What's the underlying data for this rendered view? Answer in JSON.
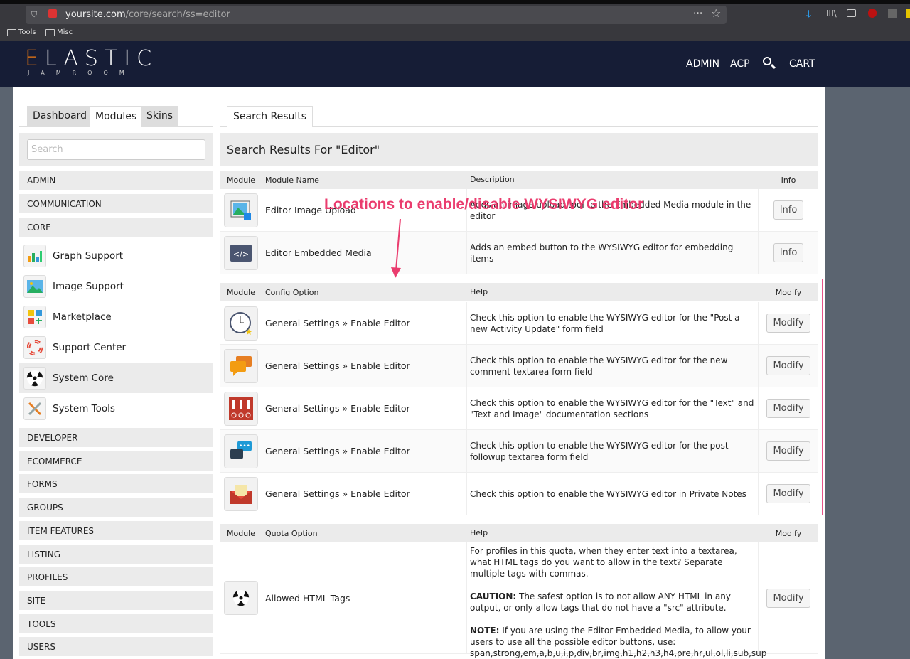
{
  "browser": {
    "url_domain": "yoursite.com",
    "url_path": "/core/search/ss=editor",
    "bookmarks": [
      "Tools",
      "Misc"
    ]
  },
  "header": {
    "logo_main": "ELASTIC",
    "logo_sub": "JAMROOM",
    "nav": [
      "ADMIN",
      "ACP",
      "CART"
    ],
    "search_icon": "search-icon"
  },
  "tabs": {
    "left": [
      "Dashboard",
      "Modules",
      "Skins"
    ],
    "active": "Modules",
    "right": "Search Results"
  },
  "sidebar": {
    "search_placeholder": "Search",
    "categories_top": [
      "ADMIN",
      "COMMUNICATION",
      "CORE"
    ],
    "modules": [
      {
        "label": "Graph Support",
        "icon": "bar-chart-icon"
      },
      {
        "label": "Image Support",
        "icon": "image-icon"
      },
      {
        "label": "Marketplace",
        "icon": "grid-plus-icon"
      },
      {
        "label": "Support Center",
        "icon": "lifebuoy-icon"
      },
      {
        "label": "System Core",
        "icon": "radiation-icon",
        "selected": true
      },
      {
        "label": "System Tools",
        "icon": "tools-icon"
      }
    ],
    "categories_bottom": [
      "DEVELOPER",
      "ECOMMERCE",
      "FORMS",
      "GROUPS",
      "ITEM FEATURES",
      "LISTING",
      "PROFILES",
      "SITE",
      "TOOLS",
      "USERS"
    ]
  },
  "main": {
    "title": "Search Results For \"Editor\"",
    "modules_table": {
      "headers": [
        "Module",
        "Module Name",
        "Description",
        "Info"
      ],
      "rows": [
        {
          "name": "Editor Image Upload",
          "desc": "Adds an image upload tool to the Embedded Media module in the editor",
          "button": "Info",
          "icon": "image-upload-icon"
        },
        {
          "name": "Editor Embedded Media",
          "desc": "Adds an embed button to the WYSIWYG editor for embedding items",
          "button": "Info",
          "icon": "code-icon"
        }
      ]
    },
    "config_table": {
      "headers": [
        "Module",
        "Config Option",
        "Help",
        "Modify"
      ],
      "rows": [
        {
          "name": "General Settings » Enable Editor",
          "help": "Check this option to enable the WYSIWYG editor for the \"Post a new Activity Update\" form field",
          "button": "Modify",
          "icon": "clock-star-icon"
        },
        {
          "name": "General Settings » Enable Editor",
          "help": "Check this option to enable the WYSIWYG editor for the new comment textarea form field",
          "button": "Modify",
          "icon": "comments-icon"
        },
        {
          "name": "General Settings » Enable Editor",
          "help": "Check this option to enable the WYSIWYG editor for the \"Text\" and \"Text and Image\" documentation sections",
          "button": "Modify",
          "icon": "binders-icon"
        },
        {
          "name": "General Settings » Enable Editor",
          "help": "Check this option to enable the WYSIWYG editor for the post followup textarea form field",
          "button": "Modify",
          "icon": "chat-bubbles-icon"
        },
        {
          "name": "General Settings » Enable Editor",
          "help": "Check this option to enable the WYSIWYG editor in Private Notes",
          "button": "Modify",
          "icon": "envelope-icon"
        }
      ]
    },
    "quota_table": {
      "headers": [
        "Module",
        "Quota Option",
        "Help",
        "Modify"
      ],
      "row": {
        "name": "Allowed HTML Tags",
        "help1": "For profiles in this quota, when they enter text into a textarea, what HTML tags do you want to allow in the text? Separate multiple tags with commas.",
        "caution_label": "CAUTION:",
        "caution": " The safest option is to not allow ANY HTML in any output, or only allow tags that do not have a \"src\" attribute.",
        "note_label": "NOTE:",
        "note": " If you are using the Editor Embedded Media, to allow your users to use all the possible editor buttons, use:",
        "tags": "span,strong,em,a,b,u,i,p,div,br,img,h1,h2,h3,h4,pre,hr,ul,ol,li,sub,sup",
        "button": "Modify",
        "icon": "radiation-icon"
      }
    }
  },
  "annotation": {
    "text": "Locations to enable/disable WYSIWYG editor",
    "color": "#ea3c6e"
  },
  "colors": {
    "header": "#161d36",
    "logo_accent": "#f07b12",
    "outer_bg": "#5b6470"
  }
}
